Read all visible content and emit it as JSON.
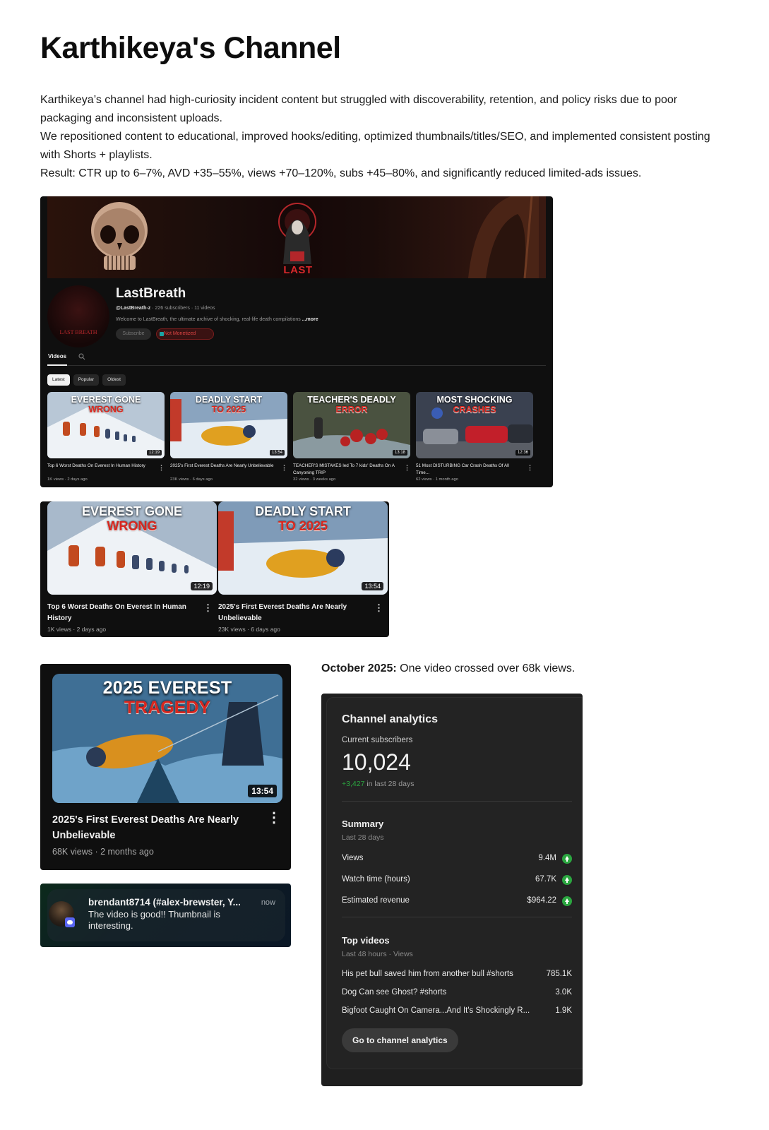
{
  "page": {
    "title": "Karthikeya's Channel",
    "intro": [
      "Karthikeya’s channel had high-curiosity incident content but struggled with discoverability, retention, and policy risks due to poor packaging and inconsistent uploads.",
      "We repositioned content to educational, improved hooks/editing, optimized thumbnails/titles/SEO, and implemented consistent posting with Shorts + playlists.",
      "Result: CTR up to 6–7%, AVD +35–55%, views +70–120%, subs +45–80%, and significantly reduced limited-ads issues."
    ]
  },
  "channel": {
    "banner_brand": "LAST BREATH",
    "avatar_text": "LAST BREATH",
    "name": "LastBreath",
    "handle": "@LastBreath-z",
    "stats": "· 226 subscribers · 11 videos",
    "description": "Welcome to LastBreath, the ultimate archive of shocking, real-life death compilations",
    "more_label": "...more",
    "subscribe_label": "Subscribe",
    "badge_label": "Not Monetized",
    "tab_videos": "Videos",
    "chips": [
      "Latest",
      "Popular",
      "Oldest"
    ],
    "videos": [
      {
        "line1": "EVEREST GONE",
        "line2": "WRONG",
        "duration": "12:19",
        "title": "Top 6 Worst Deaths On Everest In Human History",
        "stats": "1K views · 2 days ago",
        "scene": "climbers"
      },
      {
        "line1": "DEADLY START",
        "line2": "TO 2025",
        "duration": "13:54",
        "title": "2025's First Everest Deaths Are Nearly Unbelievable",
        "stats": "23K views · 6 days ago",
        "scene": "snow"
      },
      {
        "line1": "TEACHER'S DEADLY",
        "line2": "ERROR",
        "duration": "13:18",
        "title": "TEACHER'S MISTAKES led To 7 kids' Deaths On A Canyoning TRIP",
        "stats": "32 views · 3 weeks ago",
        "scene": "river"
      },
      {
        "line1": "MOST SHOCKING",
        "line2": "CRASHES",
        "duration": "12:36",
        "title": "51 Most DISTURBING Car Crash Deaths Of All Time...",
        "stats": "62 views · 1 month ago",
        "scene": "cars"
      }
    ]
  },
  "zoomed": [
    {
      "line1": "EVEREST GONE",
      "line2": "WRONG",
      "duration": "12:19",
      "title": "Top 6 Worst Deaths On Everest In Human History",
      "stats": "1K views · 2 days ago"
    },
    {
      "line1": "DEADLY START",
      "line2": "TO 2025",
      "duration": "13:54",
      "title": "2025's First Everest Deaths Are Nearly Unbelievable",
      "stats": "23K views · 6 days ago"
    }
  ],
  "big_video": {
    "line1": "2025 EVEREST",
    "line2": "TRAGEDY",
    "duration": "13:54",
    "title": "2025's First Everest Deaths Are Nearly Unbelievable",
    "stats": "68K views · 2 months ago"
  },
  "notification": {
    "user": "brendant8714 (#alex-brewster, Y...",
    "time": "now",
    "message": "The video is good!! Thumbnail is interesting.",
    "app_icon": "discord-icon"
  },
  "analytics": {
    "caption_bold": "October 2025:",
    "caption_text": " One video crossed over 68k views.",
    "title": "Channel analytics",
    "subs_label": "Current subscribers",
    "subs_count": "10,024",
    "subs_delta": "+3,427",
    "subs_delta_suffix": " in last 28 days",
    "summary_title": "Summary",
    "summary_period": "Last 28 days",
    "summary_rows": [
      {
        "label": "Views",
        "value": "9.4M"
      },
      {
        "label": "Watch time (hours)",
        "value": "67.7K"
      },
      {
        "label": "Estimated revenue",
        "value": "$964.22"
      }
    ],
    "top_title": "Top videos",
    "top_period": "Last 48 hours · Views",
    "top_rows": [
      {
        "label": "His pet bull saved him from another bull #shorts",
        "value": "785.1K"
      },
      {
        "label": "Dog Can see Ghost? #shorts",
        "value": "3.0K"
      },
      {
        "label": "Bigfoot Caught On Camera...And It's Shockingly R...",
        "value": "1.9K"
      }
    ],
    "button_label": "Go to channel analytics",
    "positive_color": "#2ba640"
  }
}
